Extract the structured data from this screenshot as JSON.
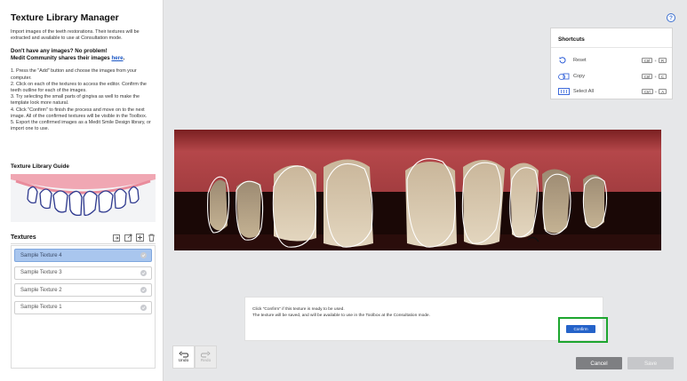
{
  "left_panel": {
    "title": "Texture Library Manager",
    "intro": "Import images of the teeth restorations. Their textures will be extracted and available to use at Consultation mode.",
    "no_images_q": "Don't have any images? No problem!",
    "community_text": "Medit Community shares their images ",
    "community_link": "here",
    "community_period": ".",
    "steps": [
      "1. Press the \"Add\" button and choose the images from your computer.",
      "2. Click on each of the textures to access the editor. Confirm the teeth outline for each of the images.",
      "3. Try selecting the small parts of gingiva as well to make the template look more natural.",
      "4. Click \"Confirm\" to finish the process and move on to the next image. All of the confirmed textures will be visible in the Toolbox.",
      "5. Export the confirmed images as a Medit Smile Design library, or import one to use."
    ],
    "guide_title": "Texture Library Guide",
    "textures_title": "Textures",
    "textures": [
      {
        "label": "Sample Texture 4",
        "selected": true
      },
      {
        "label": "Sample Texture 3",
        "selected": false
      },
      {
        "label": "Sample Texture 2",
        "selected": false
      },
      {
        "label": "Sample Texture 1",
        "selected": false
      }
    ]
  },
  "shortcuts": {
    "title": "Shortcuts",
    "items": [
      {
        "label": "Reset",
        "icon": "reset-icon",
        "mod": "Ctrl",
        "plus": "+",
        "key": "R"
      },
      {
        "label": "Copy",
        "icon": "copy-icon",
        "mod": "Ctrl",
        "plus": "+",
        "key": "C"
      },
      {
        "label": "Select All",
        "icon": "select-all-icon",
        "mod": "Ctrl",
        "plus": "+",
        "key": "A"
      }
    ]
  },
  "help_label": "?",
  "confirm_panel": {
    "line1": "Click \"Confirm\" if this texture is ready to be used.",
    "line2": "The texture will be saved, and will be available to use in the Toolbox at the Consultation mode.",
    "confirm_label": "Confirm"
  },
  "history": {
    "undo_label": "Undo",
    "redo_label": "Redo"
  },
  "footer": {
    "cancel_label": "Cancel",
    "save_label": "Save"
  },
  "colors": {
    "accent": "#2563c9",
    "highlight": "#1da62f",
    "selected_row": "#a9c6ee"
  }
}
